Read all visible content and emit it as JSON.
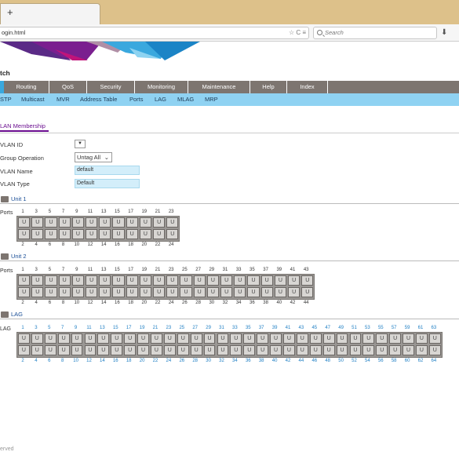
{
  "browser": {
    "new_tab_label": "+",
    "url": "ogin.html",
    "url_icons": "☆ C ≡",
    "search_placeholder": "Search",
    "download_glyph": "⬇"
  },
  "app_title": "tch",
  "main_nav": [
    "Routing",
    "QoS",
    "Security",
    "Monitoring",
    "Maintenance",
    "Help",
    "Index"
  ],
  "sub_nav": [
    "STP",
    "Multicast",
    "MVR",
    "Address Table",
    "Ports",
    "LAG",
    "MLAG",
    "MRP"
  ],
  "section_tab": "LAN Membership",
  "form": {
    "vlan_id_label": "VLAN ID",
    "vlan_id_glyph": "▼",
    "group_op_label": "Group Operation",
    "group_op_value": "Untag All",
    "vlan_name_label": "VLAN Name",
    "vlan_name_value": "default",
    "vlan_type_label": "VLAN Type",
    "vlan_type_value": "Default"
  },
  "port_glyph": "U",
  "units": [
    {
      "title": "Unit 1",
      "row_label": "Ports",
      "top_numbers": [
        "1",
        "3",
        "5",
        "7",
        "9",
        "11",
        "13",
        "15",
        "17",
        "19",
        "21",
        "23"
      ],
      "bottom_numbers": [
        "2",
        "4",
        "6",
        "8",
        "10",
        "12",
        "14",
        "16",
        "18",
        "20",
        "22",
        "24"
      ]
    },
    {
      "title": "Unit 2",
      "row_label": "Ports",
      "top_numbers": [
        "1",
        "3",
        "5",
        "7",
        "9",
        "11",
        "13",
        "15",
        "17",
        "19",
        "21",
        "23",
        "25",
        "27",
        "29",
        "31",
        "33",
        "35",
        "37",
        "39",
        "41",
        "43"
      ],
      "bottom_numbers": [
        "2",
        "4",
        "6",
        "8",
        "10",
        "12",
        "14",
        "16",
        "18",
        "20",
        "22",
        "24",
        "26",
        "28",
        "30",
        "32",
        "34",
        "36",
        "38",
        "40",
        "42",
        "44"
      ]
    },
    {
      "title": "LAG",
      "row_label": "LAG",
      "top_numbers": [
        "1",
        "3",
        "5",
        "7",
        "9",
        "11",
        "13",
        "15",
        "17",
        "19",
        "21",
        "23",
        "25",
        "27",
        "29",
        "31",
        "33",
        "35",
        "37",
        "39",
        "41",
        "43",
        "45",
        "47",
        "49",
        "51",
        "53",
        "55",
        "57",
        "59",
        "61",
        "63"
      ],
      "bottom_numbers": [
        "2",
        "4",
        "6",
        "8",
        "10",
        "12",
        "14",
        "16",
        "18",
        "20",
        "22",
        "24",
        "26",
        "28",
        "30",
        "32",
        "34",
        "36",
        "38",
        "40",
        "42",
        "44",
        "46",
        "48",
        "50",
        "52",
        "54",
        "56",
        "58",
        "60",
        "62",
        "64"
      ]
    }
  ],
  "footer": "erved",
  "colors": {
    "chrome": "#ddc18a",
    "main_nav": "#7d7570",
    "sub_nav": "#8fd2f2",
    "accent": "#6a0d8f",
    "lag_numbers": "#1f7fc4"
  }
}
